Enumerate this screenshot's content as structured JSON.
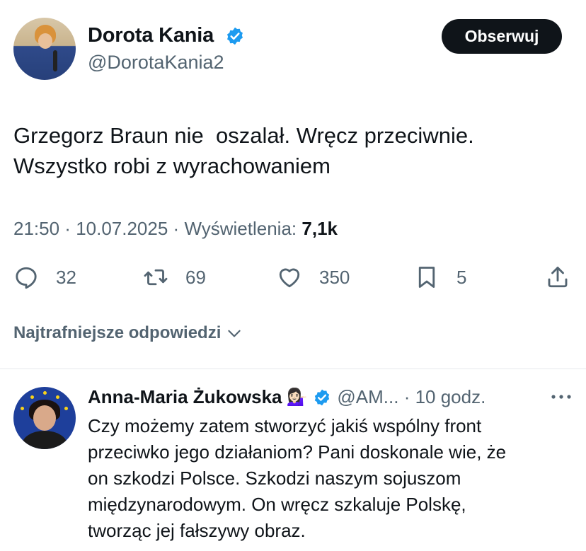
{
  "tweet": {
    "author_name": "Dorota Kania",
    "author_handle": "@DorotaKania2",
    "follow_label": "Obserwuj",
    "text": "Grzegorz Braun nie  oszalał. Wręcz przeciwnie.\nWszystko robi z wyrachowaniem",
    "time": "21:50",
    "date": "10.07.2025",
    "views_label": "Wyświetlenia:",
    "views_value": "7,1k",
    "replies": "32",
    "retweets": "69",
    "likes": "350",
    "bookmarks": "5"
  },
  "best_replies_label": "Najtrafniejsze odpowiedzi",
  "reply": {
    "author_name": "Anna-Maria Żukowska",
    "emoji": "💁🏻‍♀️",
    "handle_time": "@AM... · 10 godz.",
    "text": "Czy możemy zatem stworzyć jakiś wspólny front\nprzeciwko jego działaniom? Pani doskonale wie, że\non szkodzi Polsce. Szkodzi naszym sojuszom\nmiędzynarodowym. On wręcz szkaluje Polskę,\ntworząc jej fałszywy obraz."
  },
  "colors": {
    "verified_blue": "#1d9bf0",
    "text_primary": "#0f1419",
    "text_secondary": "#536471"
  },
  "icons": [
    "reply-icon",
    "retweet-icon",
    "like-icon",
    "bookmark-icon",
    "share-icon",
    "chevron-down-icon",
    "verified-badge-icon",
    "more-icon"
  ]
}
